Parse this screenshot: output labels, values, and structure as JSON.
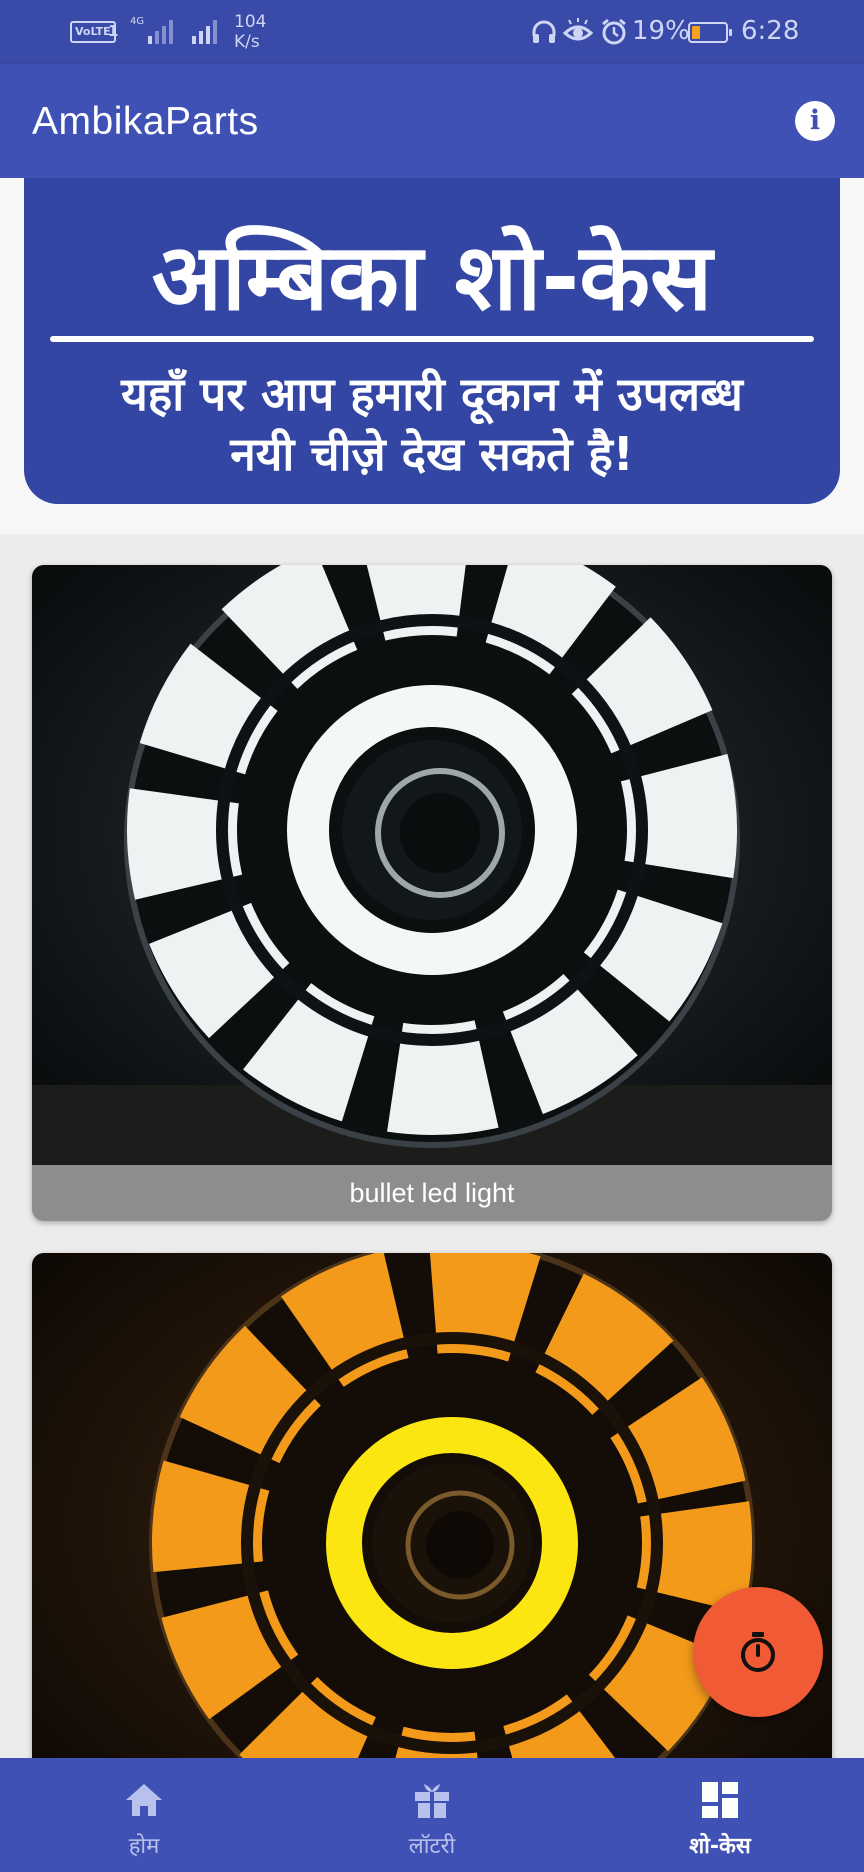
{
  "status_bar": {
    "volte": "VoLTE",
    "sim1": "1",
    "network": "4G",
    "speed_value": "104",
    "speed_unit": "K/s",
    "battery_percent": "19%",
    "time": "6:28"
  },
  "app_bar": {
    "title": "AmbikaParts",
    "info_icon": "info-icon"
  },
  "banner": {
    "title": "अम्बिका शो-केस",
    "subtitle_line1": "यहाँ पर आप हमारी दूकान में उपलब्ध",
    "subtitle_line2": "नयी चीज़े देख सकते है!"
  },
  "showcase": {
    "items": [
      {
        "caption": "bullet led light",
        "glow": "white"
      },
      {
        "caption": "",
        "glow": "amber"
      }
    ]
  },
  "fab": {
    "icon": "timer-icon"
  },
  "bottom_nav": {
    "items": [
      {
        "label": "होम",
        "icon": "home-icon"
      },
      {
        "label": "लॉटरी",
        "icon": "gift-icon"
      },
      {
        "label": "शो-केस",
        "icon": "dashboard-icon",
        "active": true
      }
    ]
  },
  "colors": {
    "primary": "#3f51b5",
    "status_bar": "#3a4aa8",
    "banner": "#3346a3",
    "fab": "#f05a35",
    "caption_bg": "#8d8d8d",
    "battery": "#f5a21b"
  }
}
